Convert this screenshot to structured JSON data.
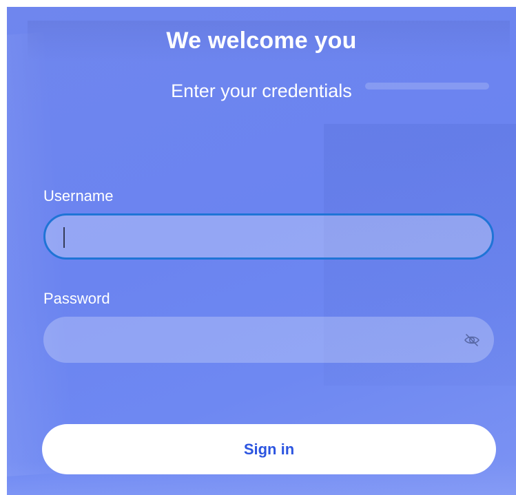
{
  "header": {
    "title": "We welcome you",
    "subtitle": "Enter your credentials"
  },
  "form": {
    "username": {
      "label": "Username",
      "value": "",
      "focused": true
    },
    "password": {
      "label": "Password",
      "value": "",
      "toggle_icon": "eye-off-icon"
    },
    "submit_label": "Sign in"
  },
  "colors": {
    "background": "#6b84f0",
    "focus_ring": "#1f74d6",
    "button_text": "#2c55e0",
    "text": "#ffffff"
  }
}
